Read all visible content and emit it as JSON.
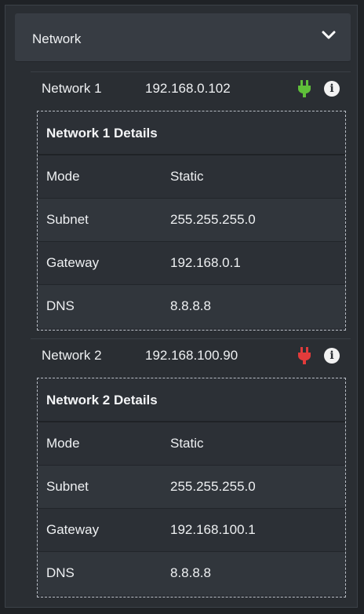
{
  "header": {
    "title": "Network"
  },
  "networks": [
    {
      "name": "Network 1",
      "ip": "192.168.0.102",
      "status_color": "#5fbf3a",
      "details_title": "Network 1 Details",
      "rows": [
        {
          "label": "Mode",
          "value": "Static"
        },
        {
          "label": "Subnet",
          "value": "255.255.255.0"
        },
        {
          "label": "Gateway",
          "value": "192.168.0.1"
        },
        {
          "label": "DNS",
          "value": "8.8.8.8"
        }
      ]
    },
    {
      "name": "Network 2",
      "ip": "192.168.100.90",
      "status_color": "#e23b3b",
      "details_title": "Network 2 Details",
      "rows": [
        {
          "label": "Mode",
          "value": "Static"
        },
        {
          "label": "Subnet",
          "value": "255.255.255.0"
        },
        {
          "label": "Gateway",
          "value": "192.168.100.1"
        },
        {
          "label": "DNS",
          "value": "8.8.8.8"
        }
      ]
    }
  ],
  "icons": {
    "info": "i"
  }
}
